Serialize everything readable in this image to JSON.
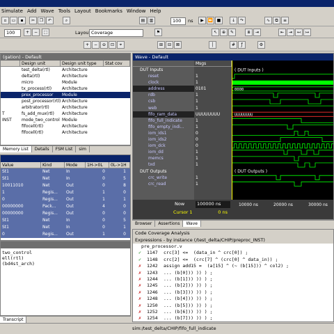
{
  "menu": [
    "Simulate",
    "Add",
    "Wave",
    "Tools",
    "Layout",
    "Bookmarks",
    "Window",
    "Help"
  ],
  "toolbar": {
    "zoom_value": "100",
    "time_value": "100",
    "time_unit": "ns",
    "layout_label": "Layout",
    "layout_value": "Coverage"
  },
  "instances": {
    "title": "(gation) - Default",
    "columns": [
      "",
      "Design unit",
      "Design unit type",
      "Stat cov"
    ],
    "rows": [
      {
        "name": "",
        "unit": "test_delta(rtl)",
        "type": "Architecture"
      },
      {
        "name": "",
        "unit": "delta(rtl)",
        "type": "Architecture"
      },
      {
        "name": "",
        "unit": "micro",
        "type": "Module"
      },
      {
        "name": "",
        "unit": "tx_process(rtl)",
        "type": "Architecture"
      },
      {
        "name": "",
        "unit": "prex_processor",
        "type": "Module"
      },
      {
        "name": "",
        "unit": "post_processor(rtl)",
        "type": "Architecture"
      },
      {
        "name": "",
        "unit": "arbitrator(rtl)",
        "type": "Architecture"
      },
      {
        "name": "T",
        "unit": "fs_add_mux(rtl)",
        "type": "Architecture"
      },
      {
        "name": "INST",
        "unit": "mode_two_control",
        "type": "Module"
      },
      {
        "name": "",
        "unit": "fifocell(rtl)",
        "type": "Architecture"
      },
      {
        "name": "",
        "unit": "fifocell(rtl)",
        "type": "Architecture"
      }
    ],
    "tabs": [
      "Memory List",
      "Details",
      "FSM List",
      "sim"
    ]
  },
  "objects": {
    "columns": [
      "Value",
      "Kind",
      "Mode",
      "1H->0L",
      "0L->1H"
    ],
    "rows": [
      {
        "v": "St1",
        "k": "Net",
        "m": "In",
        "a": "0",
        "b": "1"
      },
      {
        "v": "St1",
        "k": "Net",
        "m": "In",
        "a": "0",
        "b": "5"
      },
      {
        "v": "10011010",
        "k": "Net",
        "m": "Out",
        "a": "0",
        "b": "8"
      },
      {
        "v": "1",
        "k": "Regis...",
        "m": "Out",
        "a": "1",
        "b": "0"
      },
      {
        "v": "0",
        "k": "Regis...",
        "m": "Out",
        "a": "1",
        "b": "1"
      },
      {
        "v": "00000000",
        "k": "Pack...",
        "m": "Out",
        "a": "4",
        "b": "0"
      },
      {
        "v": "00000000",
        "k": "Regis...",
        "m": "Out",
        "a": "0",
        "b": "0"
      },
      {
        "v": "St1",
        "k": "Net",
        "m": "In",
        "a": "0",
        "b": "5"
      },
      {
        "v": "St1",
        "k": "Net",
        "m": "In",
        "a": "0",
        "b": "1"
      },
      {
        "v": "0",
        "k": "Regis...",
        "m": "Out",
        "a": "1",
        "b": "0"
      }
    ]
  },
  "transcript": {
    "lines": [
      "two_control",
      "ell(rtl)",
      "(bd4st_arch)"
    ],
    "tab": "Transcript",
    "status": "sim:/test_delta/CHIP/fifo_full_indicate"
  },
  "wave": {
    "title": "Wave - Default",
    "msgs_header": "Msgs",
    "signals": [
      {
        "n": "DUT Inputs",
        "v": "",
        "grp": true
      },
      {
        "n": "reset",
        "v": "1"
      },
      {
        "n": "clock",
        "v": "1"
      },
      {
        "n": "address",
        "v": "0101"
      },
      {
        "n": "rdb",
        "v": "1"
      },
      {
        "n": "csb",
        "v": "1"
      },
      {
        "n": "web",
        "v": "1"
      },
      {
        "n": "fifo_ram_data",
        "v": "UUUUUUUU"
      },
      {
        "n": "fifo_full_indicate",
        "v": "1"
      },
      {
        "n": "fifo_empty_indi...",
        "v": "1"
      },
      {
        "n": "iom_ids1",
        "v": "0"
      },
      {
        "n": "iom_ids2",
        "v": "0"
      },
      {
        "n": "iom_dck",
        "v": "0"
      },
      {
        "n": "iom_dd",
        "v": "1"
      },
      {
        "n": "memcs",
        "v": "1"
      },
      {
        "n": "txd",
        "v": "1"
      },
      {
        "n": "DUT Outputs",
        "v": "",
        "grp": true
      },
      {
        "n": "crc_write",
        "v": "1"
      },
      {
        "n": "crc_read",
        "v": "1"
      }
    ],
    "group_labels": [
      "( DUT Inputs )",
      "( DUT Outputs )"
    ],
    "bus_labels": [
      "0000",
      "UUUUUUUU"
    ],
    "now_label": "Now",
    "now_value": "100000 ns",
    "cursor_label": "Cursor 1",
    "cursor_value": "0 ns",
    "timeline": [
      "10000 ns",
      "20000 ns",
      "30000 ns"
    ],
    "tabs": [
      "Browser",
      "Assertions",
      "Wave"
    ]
  },
  "coverage": {
    "title": "Code Coverage Analysis",
    "subtitle": "Expressions - by instance (/test_delta/CHIP/preproc_INST)",
    "file": "pre_processor.v",
    "lines": [
      {
        "mark": "check",
        "n": "1147",
        "t": "crc[3] <=  (data_in ^ crc[0]) ;"
      },
      {
        "mark": "check",
        "n": "1148",
        "t": "crc[2] <=  (crc[7] ^ (crc[0] ^ data_in)) ;"
      },
      {
        "mark": "x",
        "n": "1242",
        "t": "assign add15 =  (a[15] ^ (~ (b[15])) ^ col2) ;"
      },
      {
        "mark": "x",
        "n": "1243",
        "t": "... (b[0])) )) ) ;"
      },
      {
        "mark": "x",
        "n": "1244",
        "t": "... (b[1])) )) ) ;"
      },
      {
        "mark": "x",
        "n": "1245",
        "t": "... (b[2])) )) ) ;"
      },
      {
        "mark": "x",
        "n": "1246",
        "t": "... (b[3])) )) ) ;"
      },
      {
        "mark": "x",
        "n": "1248",
        "t": "... (b[4])) )) ) ;"
      },
      {
        "mark": "x",
        "n": "1250",
        "t": "... (b[5])) )) ) ;"
      },
      {
        "mark": "x",
        "n": "1252",
        "t": "... (b[6])) )) ) ;"
      },
      {
        "mark": "x",
        "n": "1254",
        "t": "... (b[7])) )) ) ;"
      }
    ]
  },
  "colors": {
    "accent": "#0a246a",
    "wave_green": "#00ff00",
    "select_blue": "#5a6ea8"
  }
}
